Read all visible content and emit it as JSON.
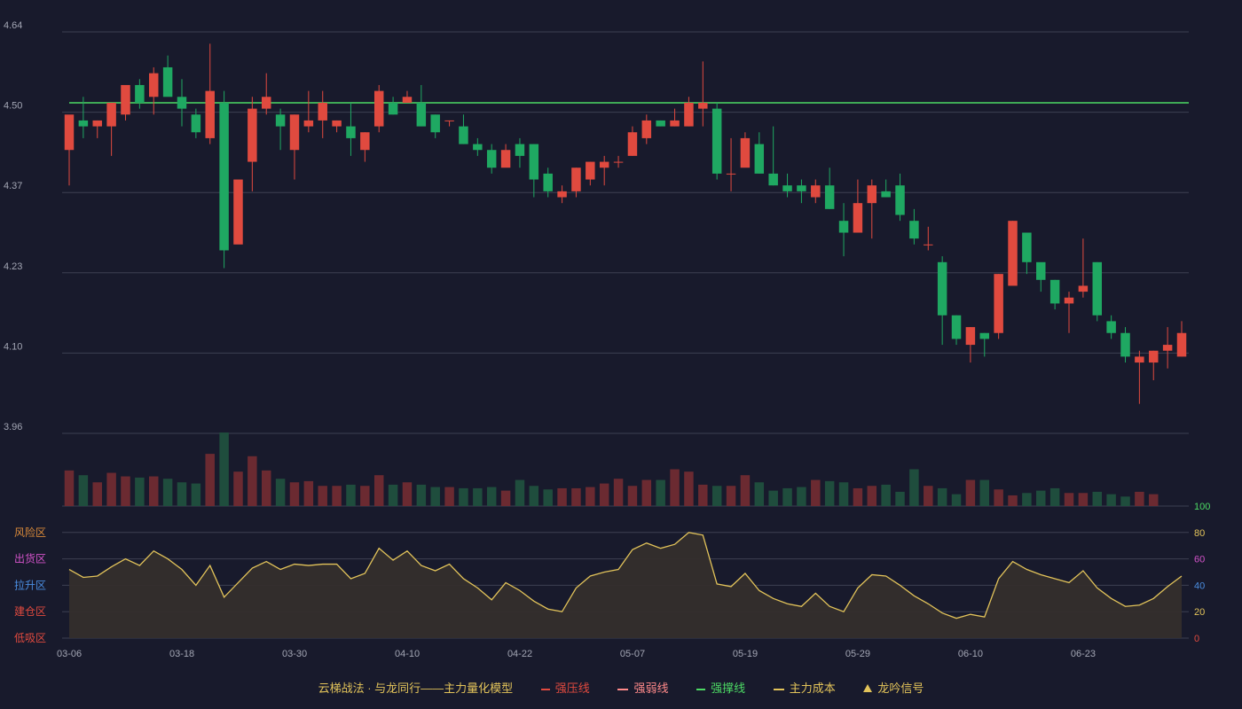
{
  "colors": {
    "background": "#181a2c",
    "up": "#e04a3f",
    "down": "#1fa862",
    "up_volume": "#6b2a31",
    "down_volume": "#1f4d3d",
    "grid": "#3d4052",
    "tick_text": "#a3a6b4",
    "strong_support": "#4cd964",
    "main_line": "#e2c35a",
    "main_fill": "#342e2c"
  },
  "chart_data": [
    {
      "type": "candlestick",
      "ylim": [
        3.96,
        4.64
      ],
      "yticks": [
        "4.64",
        "4.50",
        "4.37",
        "4.23",
        "4.10",
        "3.96"
      ],
      "x_tick_labels": [
        "03-06",
        "03-18",
        "03-30",
        "04-10",
        "04-22",
        "05-07",
        "05-19",
        "05-29",
        "06-10",
        "06-23"
      ],
      "x_tick_indices": [
        0,
        8,
        16,
        24,
        32,
        40,
        48,
        56,
        64,
        72
      ],
      "strong_support_line": 4.52,
      "ohlc": [
        [
          4.44,
          4.48,
          4.38,
          4.5
        ],
        [
          4.49,
          4.53,
          4.46,
          4.48
        ],
        [
          4.48,
          4.49,
          4.46,
          4.49
        ],
        [
          4.48,
          4.51,
          4.43,
          4.52
        ],
        [
          4.5,
          4.53,
          4.49,
          4.55
        ],
        [
          4.55,
          4.56,
          4.51,
          4.52
        ],
        [
          4.53,
          4.58,
          4.5,
          4.57
        ],
        [
          4.58,
          4.6,
          4.54,
          4.53
        ],
        [
          4.53,
          4.56,
          4.48,
          4.51
        ],
        [
          4.5,
          4.51,
          4.46,
          4.47
        ],
        [
          4.46,
          4.62,
          4.45,
          4.54
        ],
        [
          4.52,
          4.54,
          4.24,
          4.27
        ],
        [
          4.28,
          4.38,
          4.29,
          4.39
        ],
        [
          4.42,
          4.53,
          4.37,
          4.51
        ],
        [
          4.51,
          4.57,
          4.5,
          4.53
        ],
        [
          4.5,
          4.51,
          4.44,
          4.48
        ],
        [
          4.44,
          4.5,
          4.39,
          4.5
        ],
        [
          4.48,
          4.54,
          4.47,
          4.49
        ],
        [
          4.49,
          4.54,
          4.46,
          4.52
        ],
        [
          4.48,
          4.49,
          4.47,
          4.49
        ],
        [
          4.48,
          4.52,
          4.43,
          4.46
        ],
        [
          4.44,
          4.47,
          4.42,
          4.47
        ],
        [
          4.48,
          4.55,
          4.47,
          4.54
        ],
        [
          4.52,
          4.53,
          4.5,
          4.5
        ],
        [
          4.52,
          4.54,
          4.52,
          4.53
        ],
        [
          4.52,
          4.55,
          4.48,
          4.48
        ],
        [
          4.5,
          4.5,
          4.46,
          4.47
        ],
        [
          4.49,
          4.49,
          4.48,
          4.49
        ],
        [
          4.48,
          4.5,
          4.45,
          4.45
        ],
        [
          4.45,
          4.46,
          4.43,
          4.44
        ],
        [
          4.44,
          4.45,
          4.4,
          4.41
        ],
        [
          4.41,
          4.45,
          4.42,
          4.44
        ],
        [
          4.45,
          4.46,
          4.41,
          4.43
        ],
        [
          4.45,
          4.45,
          4.36,
          4.39
        ],
        [
          4.4,
          4.41,
          4.36,
          4.37
        ],
        [
          4.36,
          4.38,
          4.35,
          4.37
        ],
        [
          4.37,
          4.41,
          4.36,
          4.41
        ],
        [
          4.39,
          4.42,
          4.38,
          4.42
        ],
        [
          4.41,
          4.43,
          4.38,
          4.42
        ],
        [
          4.42,
          4.43,
          4.41,
          4.42
        ],
        [
          4.43,
          4.48,
          4.43,
          4.47
        ],
        [
          4.46,
          4.5,
          4.45,
          4.49
        ],
        [
          4.49,
          4.49,
          4.48,
          4.48
        ],
        [
          4.48,
          4.51,
          4.48,
          4.49
        ],
        [
          4.48,
          4.53,
          4.48,
          4.52
        ],
        [
          4.51,
          4.59,
          4.48,
          4.52
        ],
        [
          4.51,
          4.52,
          4.39,
          4.4
        ],
        [
          4.4,
          4.46,
          4.37,
          4.4
        ],
        [
          4.41,
          4.47,
          4.43,
          4.46
        ],
        [
          4.45,
          4.47,
          4.4,
          4.4
        ],
        [
          4.4,
          4.48,
          4.38,
          4.38
        ],
        [
          4.38,
          4.4,
          4.36,
          4.37
        ],
        [
          4.38,
          4.39,
          4.35,
          4.37
        ],
        [
          4.36,
          4.39,
          4.35,
          4.38
        ],
        [
          4.38,
          4.41,
          4.34,
          4.34
        ],
        [
          4.32,
          4.35,
          4.26,
          4.3
        ],
        [
          4.3,
          4.39,
          4.31,
          4.35
        ],
        [
          4.35,
          4.39,
          4.29,
          4.38
        ],
        [
          4.37,
          4.39,
          4.36,
          4.36
        ],
        [
          4.38,
          4.4,
          4.32,
          4.33
        ],
        [
          4.32,
          4.34,
          4.28,
          4.29
        ],
        [
          4.28,
          4.31,
          4.27,
          4.28
        ],
        [
          4.25,
          4.26,
          4.11,
          4.16
        ],
        [
          4.16,
          4.16,
          4.11,
          4.12
        ],
        [
          4.11,
          4.14,
          4.08,
          4.14
        ],
        [
          4.13,
          4.13,
          4.09,
          4.12
        ],
        [
          4.13,
          4.23,
          4.12,
          4.23
        ],
        [
          4.21,
          4.32,
          4.22,
          4.32
        ],
        [
          4.3,
          4.29,
          4.23,
          4.25
        ],
        [
          4.25,
          4.24,
          4.2,
          4.22
        ],
        [
          4.22,
          4.22,
          4.17,
          4.18
        ],
        [
          4.18,
          4.2,
          4.13,
          4.19
        ],
        [
          4.2,
          4.29,
          4.19,
          4.21
        ],
        [
          4.25,
          4.25,
          4.15,
          4.16
        ],
        [
          4.15,
          4.16,
          4.12,
          4.13
        ],
        [
          4.13,
          4.14,
          4.08,
          4.09
        ],
        [
          4.08,
          4.1,
          4.01,
          4.09
        ],
        [
          4.08,
          4.1,
          4.05,
          4.1
        ],
        [
          4.1,
          4.14,
          4.07,
          4.11
        ],
        [
          4.09,
          4.15,
          4.09,
          4.13
        ]
      ]
    },
    {
      "type": "bar",
      "title": "volume",
      "values": [
        30,
        26,
        20,
        28,
        25,
        24,
        25,
        23,
        20,
        19,
        44,
        62,
        29,
        42,
        30,
        23,
        20,
        21,
        17,
        17,
        18,
        17,
        26,
        18,
        20,
        18,
        16,
        16,
        15,
        15,
        16,
        13,
        22,
        17,
        14,
        15,
        15,
        16,
        19,
        23,
        17,
        22,
        22,
        31,
        29,
        18,
        17,
        17,
        26,
        20,
        13,
        15,
        16,
        22,
        21,
        20,
        15,
        17,
        18,
        12,
        31,
        17,
        15,
        10,
        22,
        22,
        14,
        9,
        11,
        13,
        15,
        11,
        11,
        12,
        10,
        8,
        12,
        10
      ]
    },
    {
      "type": "area",
      "title": "主力量化模型",
      "ylim": [
        0,
        100
      ],
      "yticks": [
        "100",
        "80",
        "60",
        "40",
        "20",
        "0"
      ],
      "zones": [
        "风险区",
        "出货区",
        "拉升区",
        "建仓区",
        "低吸区"
      ],
      "values": [
        52,
        46,
        47,
        54,
        60,
        55,
        66,
        60,
        52,
        40,
        55,
        31,
        42,
        53,
        58,
        52,
        56,
        55,
        56,
        56,
        45,
        49,
        68,
        59,
        66,
        55,
        51,
        56,
        45,
        38,
        29,
        42,
        36,
        28,
        22,
        20,
        38,
        47,
        50,
        52,
        67,
        72,
        68,
        71,
        80,
        78,
        41,
        39,
        49,
        36,
        30,
        26,
        24,
        34,
        24,
        20,
        38,
        48,
        47,
        40,
        32,
        26,
        19,
        15,
        18,
        16,
        45,
        58,
        52,
        48,
        45,
        42,
        51,
        38,
        30,
        24,
        25,
        30,
        39,
        47
      ]
    }
  ],
  "legend": {
    "title": "云梯战法 · 与龙同行——主力量化模型",
    "items": [
      {
        "label": "强压线",
        "color": "#e04a3f",
        "style": "line"
      },
      {
        "label": "强弱线",
        "color": "#ff8a8a",
        "style": "dash"
      },
      {
        "label": "强撑线",
        "color": "#4cd964",
        "style": "line"
      },
      {
        "label": "主力成本",
        "color": "#e2c35a",
        "style": "dash"
      },
      {
        "label": "龙吟信号",
        "color": "#e2c35a",
        "style": "triangle"
      }
    ]
  },
  "zone_colors": [
    "#d98a3a",
    "#d253c9",
    "#4a8de0",
    "#e04a3f",
    "#e04a3f"
  ],
  "right_tick_colors": [
    "#4cd964",
    "#e2c35a",
    "#d253c9",
    "#4a8de0",
    "#e2c35a",
    "#e04a3f"
  ]
}
